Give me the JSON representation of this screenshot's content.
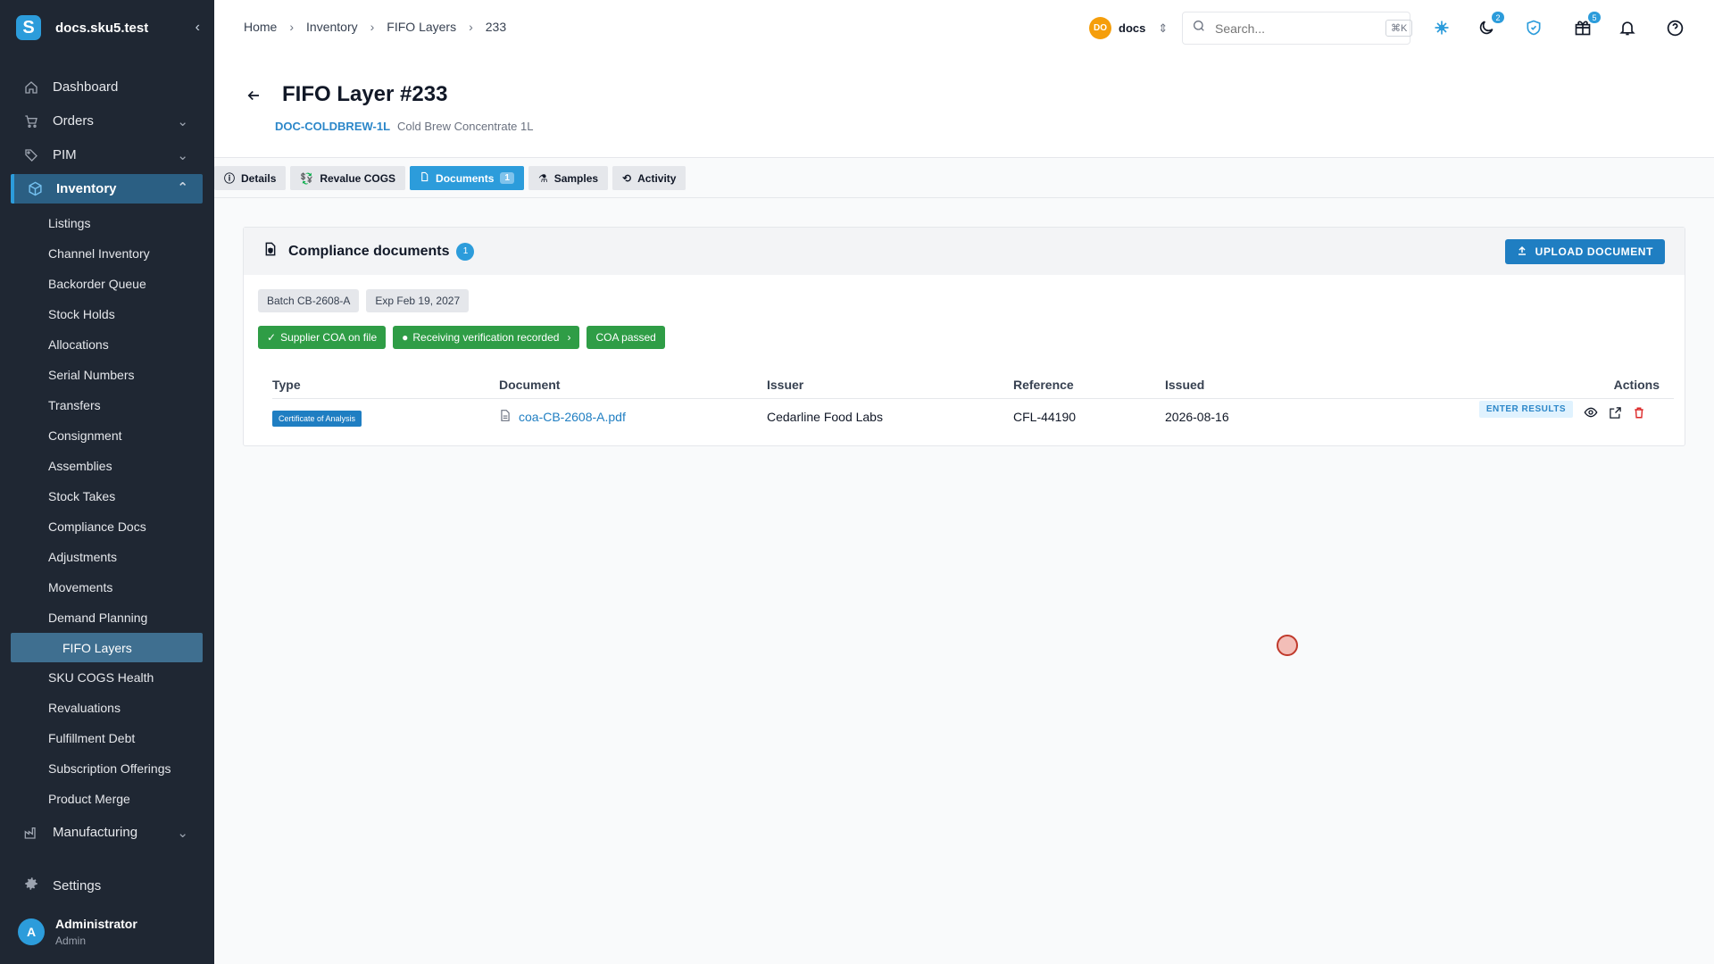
{
  "brand": {
    "logo": "S",
    "name": "docs.sku5.test"
  },
  "nav": {
    "dashboard": "Dashboard",
    "orders": "Orders",
    "pim": "PIM",
    "inventory": "Inventory",
    "inventory_items": [
      "Listings",
      "Channel Inventory",
      "Backorder Queue",
      "Stock Holds",
      "Allocations",
      "Serial Numbers",
      "Transfers",
      "Consignment",
      "Assemblies",
      "Stock Takes",
      "Compliance Docs",
      "Adjustments",
      "Movements",
      "Demand Planning",
      "FIFO Layers",
      "SKU COGS Health",
      "Revaluations",
      "Fulfillment Debt",
      "Subscription Offerings",
      "Product Merge"
    ],
    "manufacturing": "Manufacturing",
    "settings": "Settings"
  },
  "user": {
    "initial": "A",
    "name": "Administrator",
    "role": "Admin"
  },
  "breadcrumb": {
    "home": "Home",
    "inventory": "Inventory",
    "fifo": "FIFO Layers",
    "id": "233"
  },
  "org": {
    "initials": "DO",
    "name": "docs"
  },
  "search": {
    "placeholder": "Search...",
    "shortcut": "⌘K"
  },
  "notif_badges": {
    "moon": "2",
    "gift": "5"
  },
  "page": {
    "title": "FIFO Layer #233",
    "sku": "DOC-COLDBREW-1L",
    "product": "Cold Brew Concentrate 1L"
  },
  "tabs": {
    "details": "Details",
    "revalue": "Revalue COGS",
    "documents": "Documents",
    "documents_count": "1",
    "samples": "Samples",
    "activity": "Activity"
  },
  "card": {
    "title": "Compliance documents",
    "count": "1",
    "upload_label": "UPLOAD DOCUMENT",
    "chips": [
      "Batch CB-2608-A",
      "Exp Feb 19, 2027"
    ],
    "flags": [
      "Supplier COA on file",
      "Receiving verification recorded",
      "COA passed"
    ]
  },
  "table": {
    "headers": {
      "type": "Type",
      "document": "Document",
      "issuer": "Issuer",
      "reference": "Reference",
      "issued": "Issued",
      "actions": "Actions"
    },
    "rows": [
      {
        "type": "Certificate of Analysis",
        "document": "coa-CB-2608-A.pdf",
        "issuer": "Cedarline Food Labs",
        "reference": "CFL-44190",
        "issued": "2026-08-16",
        "action": "ENTER RESULTS"
      }
    ]
  },
  "colors": {
    "accent": "#2c9cdb",
    "sidebar": "#1f2733",
    "success": "#2f9d46",
    "danger": "#dc2626"
  }
}
